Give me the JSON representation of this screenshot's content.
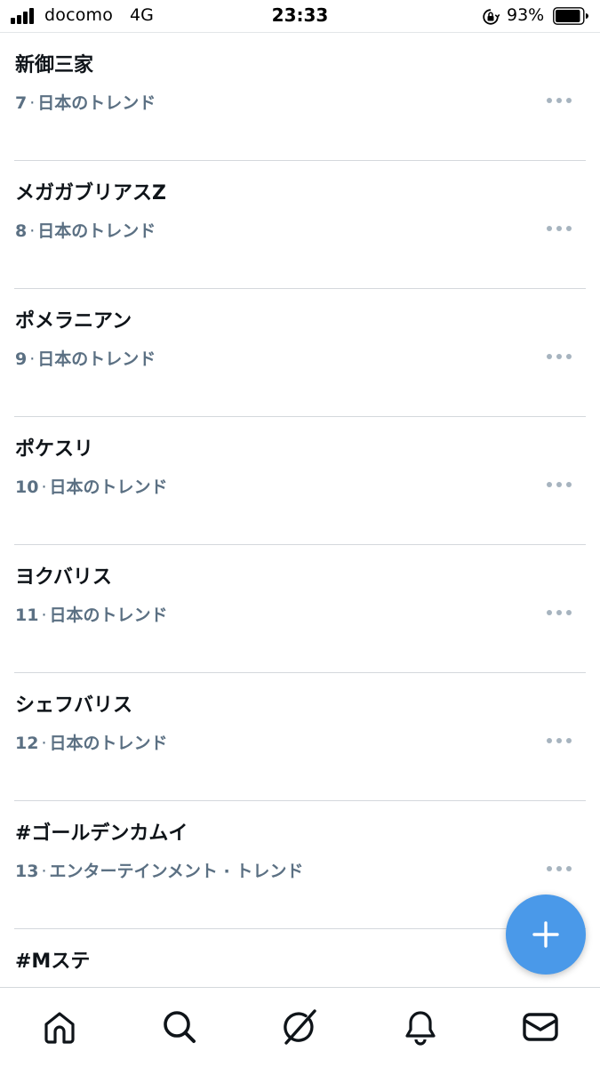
{
  "status_bar": {
    "carrier": "docomo",
    "network": "4G",
    "time": "23:33",
    "battery_percent": "93%",
    "battery_level": 0.93,
    "icons": [
      "signal-icon",
      "orientation-lock-icon",
      "battery-icon"
    ]
  },
  "trends": [
    {
      "name": "新御三家",
      "rank": "7",
      "category": "日本のトレンド"
    },
    {
      "name": "メガガブリアスZ",
      "rank": "8",
      "category": "日本のトレンド"
    },
    {
      "name": "ポメラニアン",
      "rank": "9",
      "category": "日本のトレンド"
    },
    {
      "name": "ポケスリ",
      "rank": "10",
      "category": "日本のトレンド"
    },
    {
      "name": "ヨクバリス",
      "rank": "11",
      "category": "日本のトレンド"
    },
    {
      "name": "シェフバリス",
      "rank": "12",
      "category": "日本のトレンド"
    },
    {
      "name": "#ゴールデンカムイ",
      "rank": "13",
      "category": "エンターテインメント · トレンド"
    },
    {
      "name": "#Mステ",
      "rank": "",
      "category": ""
    }
  ],
  "meta_separator": "·",
  "fab": {
    "icon": "plus-icon",
    "color": "#4a99e9"
  },
  "bottom_nav": [
    {
      "icon": "home-icon"
    },
    {
      "icon": "search-icon"
    },
    {
      "icon": "spaces-icon"
    },
    {
      "icon": "bell-icon"
    },
    {
      "icon": "mail-icon"
    }
  ],
  "colors": {
    "text_primary": "#0f1419",
    "text_secondary": "#5b7083",
    "accent": "#4a99e9",
    "divider": "#d4d8dc"
  }
}
